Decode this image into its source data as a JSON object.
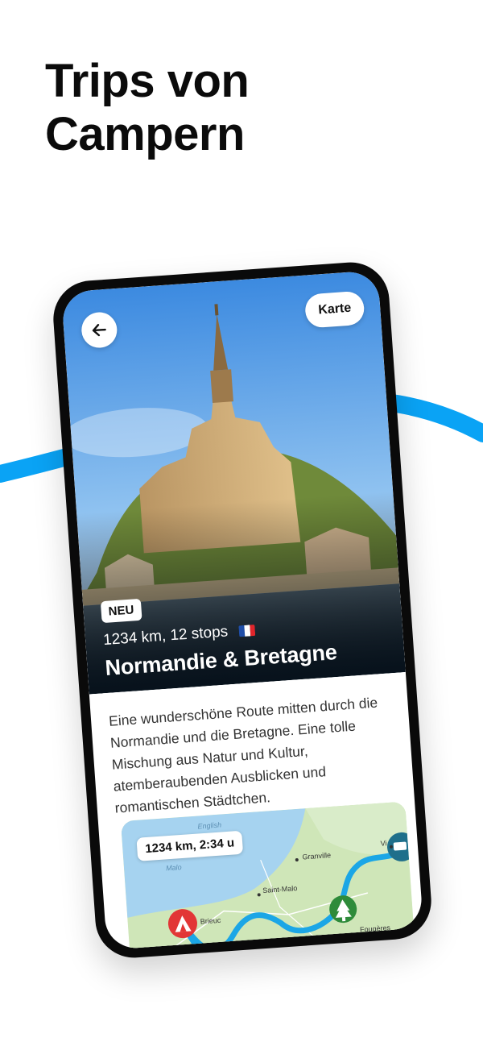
{
  "headline": {
    "line1": "Trips von",
    "line2": "Campern"
  },
  "trip": {
    "back_icon": "arrow-left-icon",
    "map_button_label": "Karte",
    "badge": "NEU",
    "meta": "1234 km, 12 stops",
    "flag": "france-flag",
    "title": "Normandie & Bretagne",
    "description": "Eine wunderschöne Route mitten durch die Normandie und die Bretagne. Eine tolle Mischung aus Natur und Kultur, atemberaubenden Ausblicken und romantischen Städtchen."
  },
  "map": {
    "summary": "1234 km, 2:34 u",
    "places": [
      "English",
      "Malo",
      "Granville",
      "Saint-Malo",
      "Brieuc",
      "Fougères",
      "Vi"
    ],
    "markers": [
      "campsite-tent-icon",
      "forest-tree-icon",
      "camper-van-icon"
    ]
  },
  "colors": {
    "accent_blue": "#0aa3f5",
    "route_blue": "#1ba6e6",
    "tent_red": "#e23636",
    "tree_green": "#2e8b3a",
    "van_teal": "#1f6f8b"
  }
}
